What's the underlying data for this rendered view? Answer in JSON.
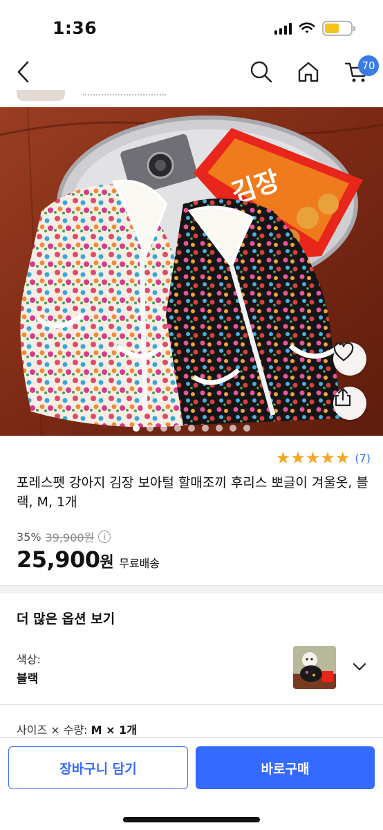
{
  "status": {
    "time": "1:36"
  },
  "nav": {
    "cart_count": "70"
  },
  "product": {
    "rating_count": "(7)",
    "stars": 5,
    "title": "포레스펫 강아지 김장 보아털 할매조끼 후리스 뽀글이 겨울옷, 블랙, M, 1개",
    "discount": "35%",
    "original_price": "39,900원",
    "price": "25,900",
    "currency": "원",
    "shipping": "무료배송",
    "image_dots": 9,
    "image_active_dot": 0
  },
  "options": {
    "title": "더 많은 옵션 보기",
    "color_label": "색상:",
    "color_value": "블랙",
    "size_label": "사이즈 × 수량:",
    "size_value": "M × 1개"
  },
  "actions": {
    "cart_label": "장바구니 담기",
    "buy_label": "바로구매"
  },
  "colors": {
    "accent": "#346aff",
    "star": "#f5a623",
    "badge": "#3b7be8"
  }
}
